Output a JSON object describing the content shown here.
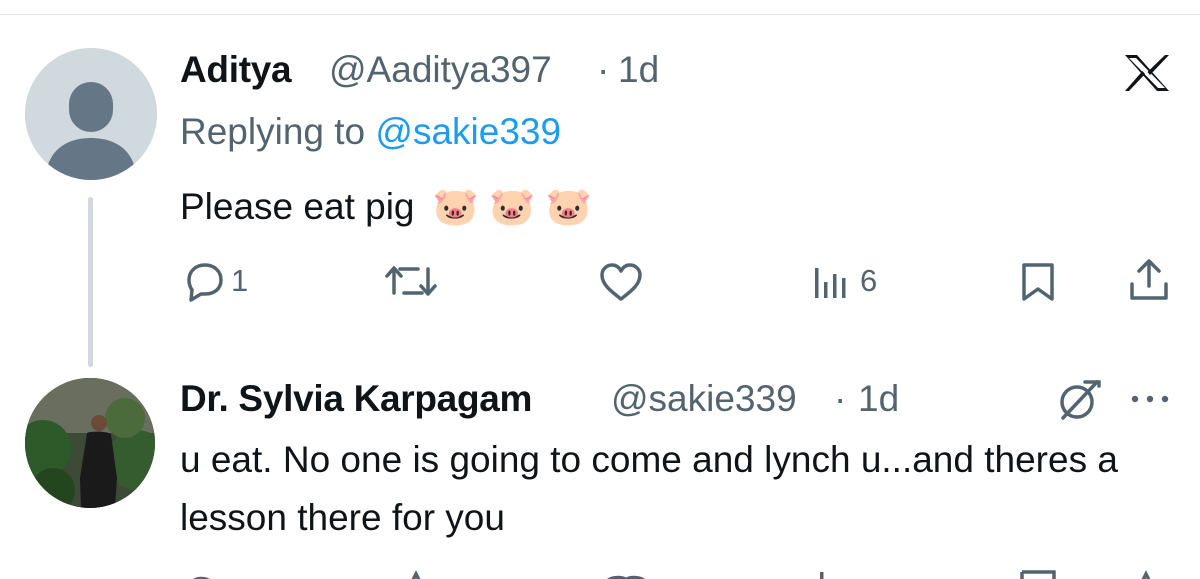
{
  "tweet1": {
    "name": "Aditya",
    "handle": "@Aaditya397",
    "separator": "·",
    "time": "1d",
    "reply_prefix": "Replying to",
    "reply_to": "@sakie339",
    "text": "Please eat pig",
    "emoji": [
      "🐷",
      "🐷",
      "🐷"
    ],
    "actions": {
      "reply_count": "1",
      "retweet_count": "",
      "like_count": "",
      "views_count": "6"
    }
  },
  "tweet2": {
    "name": "Dr. Sylvia Karpagam",
    "handle": "@sakie339",
    "separator": "·",
    "time": "1d",
    "text": "u eat. No one is going to come and lynch u...and theres a lesson there for you"
  },
  "icons": {
    "x_logo": "x-logo-icon",
    "reply": "reply-icon",
    "retweet": "retweet-icon",
    "like": "heart-icon",
    "views": "views-icon",
    "bookmark": "bookmark-icon",
    "share": "share-icon",
    "grok": "grok-icon",
    "more": "more-icon"
  },
  "colors": {
    "text": "#0f1419",
    "secondary": "#536471",
    "link": "#1d9bf0",
    "line": "#cfd9de"
  }
}
